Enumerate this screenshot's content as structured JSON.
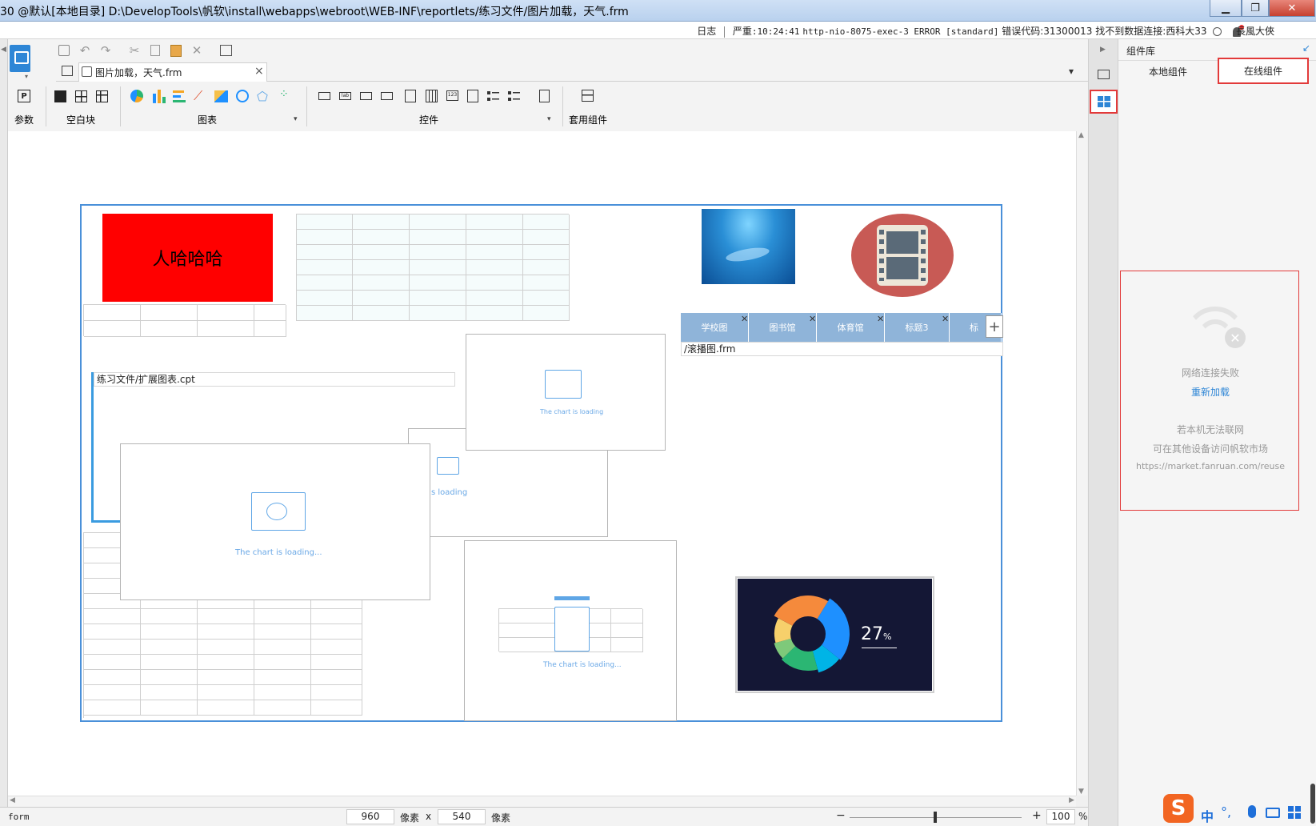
{
  "window": {
    "title": "30 @默认[本地目录]      D:\\DevelopTools\\帆软\\install\\webapps\\webroot\\WEB-INF\\reportlets/练习文件/图片加载，天气.frm",
    "buttons": {
      "minimize": "▁",
      "restore": "❐",
      "close": "✕"
    }
  },
  "topstatus": {
    "log_label": "日志",
    "level": "严重",
    "time": ":10:24:41",
    "thread": "http-nio-8075-exec-3 ERROR [standard]",
    "error_prefix": "错误代码:31300013",
    "error_msg": "找不到数据连接:西科大33",
    "user": "長風大俠"
  },
  "tab": {
    "label": "图片加载，天气.frm"
  },
  "toolbar_groups": {
    "param": "参数",
    "blank": "空白块",
    "chart": "图表",
    "widget": "控件",
    "reuse": "套用组件"
  },
  "canvas": {
    "red_box_text": "人哈哈哈",
    "report_path": "练习文件/扩展图表.cpt",
    "carousel_path": "/滚播图.frm",
    "carousel_tabs": [
      "学校图",
      "图书馆",
      "体育馆",
      "标题3",
      "标"
    ],
    "loading_text": "The chart is loading...",
    "loading_text_small": "The chart is loading",
    "loading_text_cut": "s loading",
    "loading_text_bottom": "The chart is loading...",
    "donut_percent": "27",
    "donut_unit": "%",
    "donut_colors": [
      "#1e90ff",
      "#00b4e6",
      "#2bb673",
      "#7ec97a",
      "#f7d06b",
      "#f58a3c"
    ]
  },
  "right_panel": {
    "title": "组件库",
    "tab_local": "本地组件",
    "tab_online": "在线组件",
    "err_title": "网络连接失败",
    "reload": "重新加载",
    "hint1": "若本机无法联网",
    "hint2": "可在其他设备访问帆软市场",
    "url": "https://market.fanruan.com/reuse"
  },
  "bottom": {
    "form_label": "form",
    "width": "960",
    "unit1": "像素",
    "times": "x",
    "height": "540",
    "unit2": "像素",
    "zoom": "100",
    "zoom_unit": "%",
    "minus": "−",
    "plus": "+"
  },
  "ime": {
    "logo": "S",
    "lang": "中",
    "punct": "°,"
  }
}
